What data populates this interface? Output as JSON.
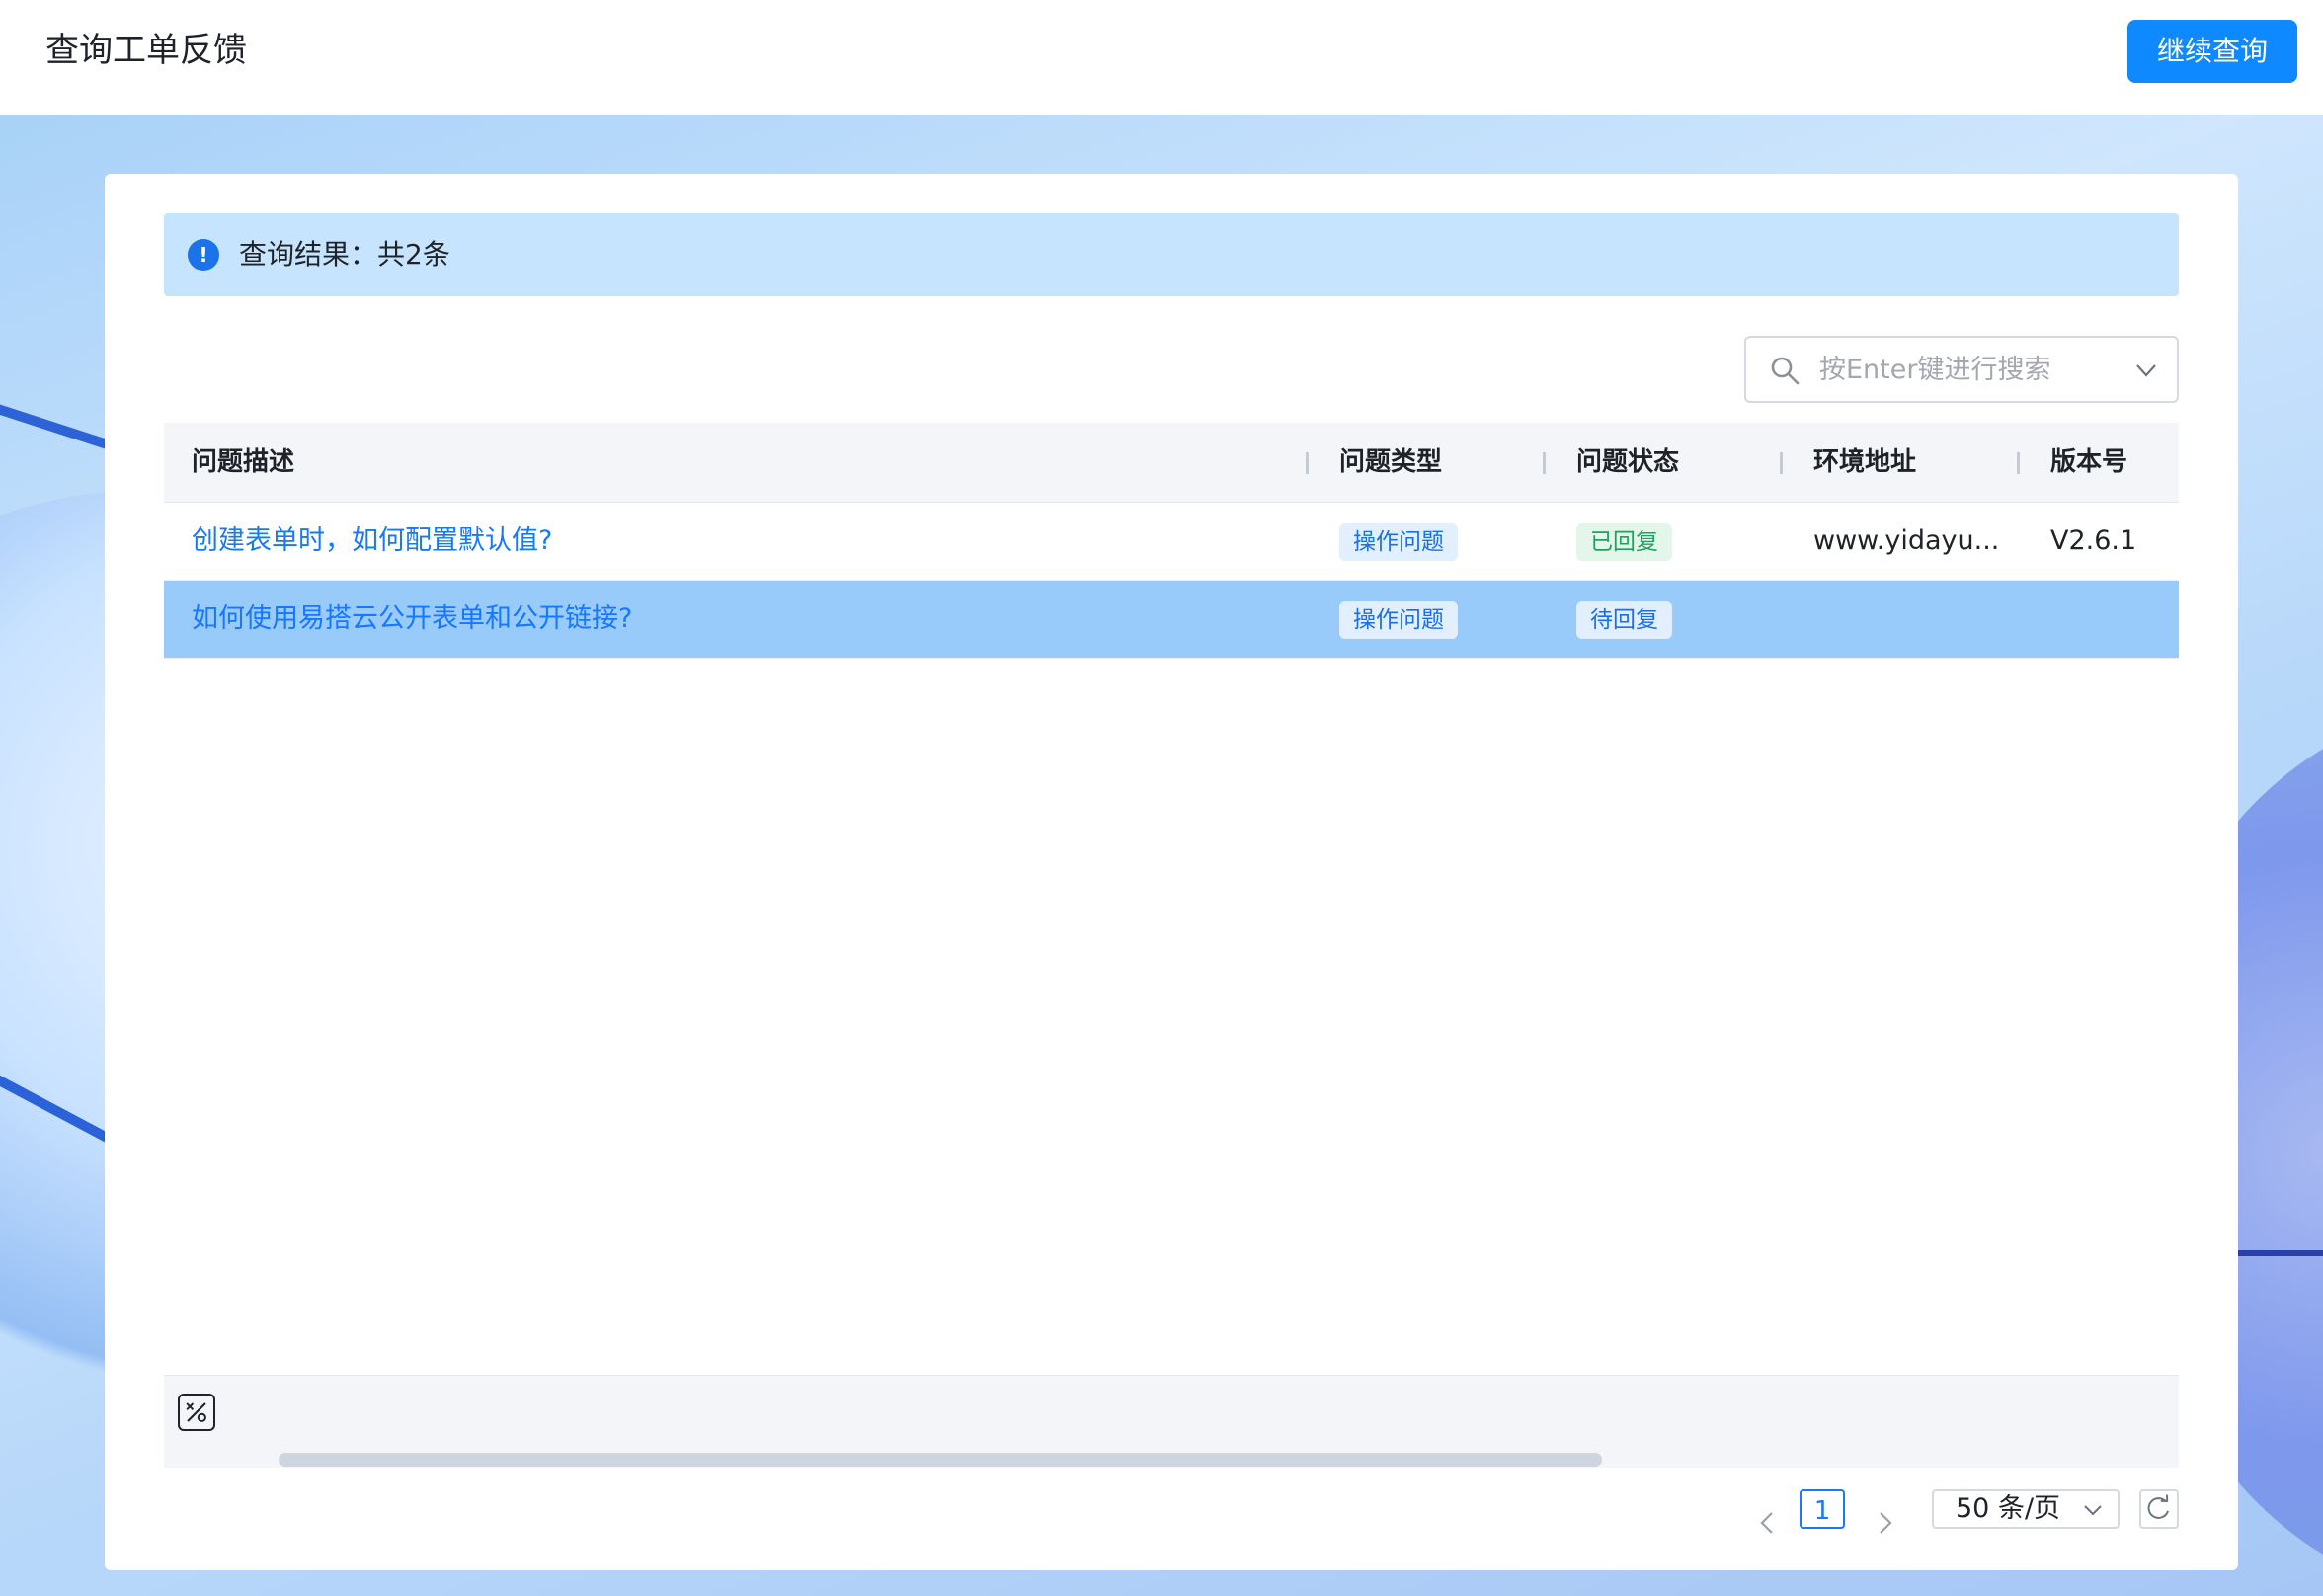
{
  "header": {
    "title": "查询工单反馈",
    "continue_label": "继续查询"
  },
  "notice": {
    "text": "查询结果：共2条"
  },
  "search": {
    "placeholder": "按Enter键进行搜索",
    "value": ""
  },
  "table": {
    "columns": [
      "问题描述",
      "问题类型",
      "问题状态",
      "环境地址",
      "版本号"
    ],
    "rows": [
      {
        "description": "创建表单时，如何配置默认值?",
        "type": "操作问题",
        "status": "已回复",
        "status_color": "green",
        "env": "www.yidayu...",
        "version": "V2.6.1",
        "selected": false
      },
      {
        "description": "如何使用易搭云公开表单和公开链接?",
        "type": "操作问题",
        "status": "待回复",
        "status_color": "blue",
        "env": "",
        "version": "",
        "selected": true
      }
    ]
  },
  "pagination": {
    "current_page": "1",
    "page_size": "50 条/页"
  },
  "colors": {
    "accent": "#1677ff",
    "button": "#0e89ff",
    "selected_row": "#98cafa",
    "notice_bg": "#c6e4fd"
  },
  "icons": {
    "notice": "info-icon",
    "search": "search-icon",
    "dropdown": "chevron-down-icon",
    "footer": "percent-formula-icon",
    "prev": "chevron-left-icon",
    "next": "chevron-right-icon",
    "refresh": "refresh-icon"
  }
}
